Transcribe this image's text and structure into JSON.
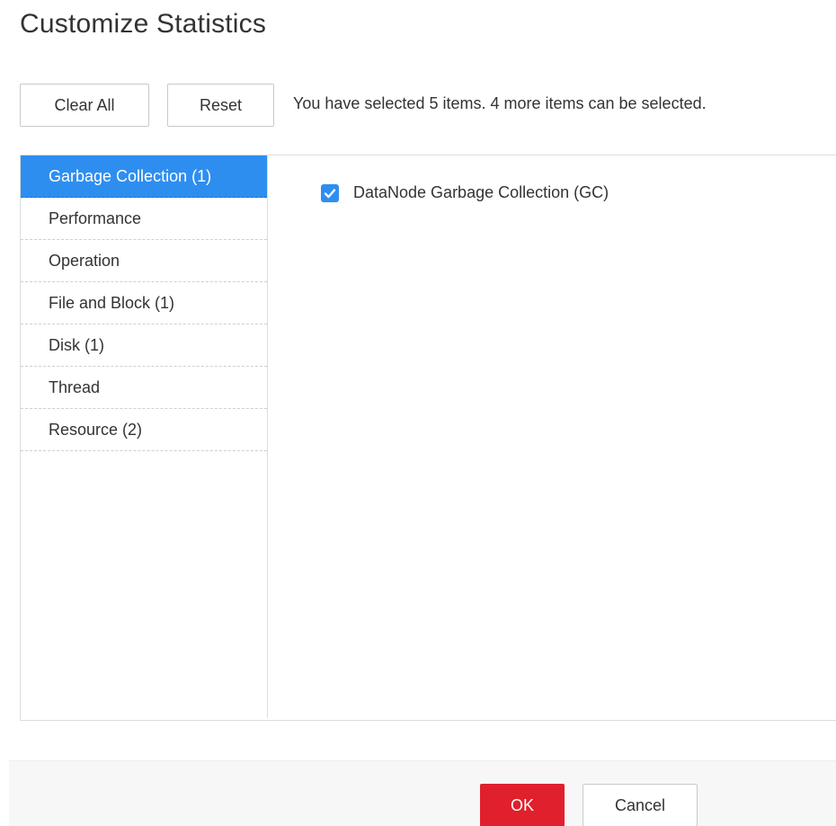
{
  "dialog": {
    "title": "Customize Statistics"
  },
  "toolbar": {
    "clear_all_label": "Clear All",
    "reset_label": "Reset",
    "selection_info": "You have selected 5 items. 4 more items can be selected."
  },
  "categories": {
    "items": [
      {
        "label": "Garbage Collection (1)",
        "active": true
      },
      {
        "label": "Performance",
        "active": false
      },
      {
        "label": "Operation",
        "active": false
      },
      {
        "label": "File and Block (1)",
        "active": false
      },
      {
        "label": "Disk (1)",
        "active": false
      },
      {
        "label": "Thread",
        "active": false
      },
      {
        "label": "Resource (2)",
        "active": false
      }
    ]
  },
  "metrics": {
    "items": [
      {
        "label": "DataNode Garbage Collection (GC)",
        "checked": true
      }
    ]
  },
  "footer": {
    "ok_label": "OK",
    "cancel_label": "Cancel"
  },
  "colors": {
    "accent": "#2e8ef0",
    "primary_button": "#e0202c"
  },
  "icons": {
    "checkbox": "checkmark-icon"
  }
}
